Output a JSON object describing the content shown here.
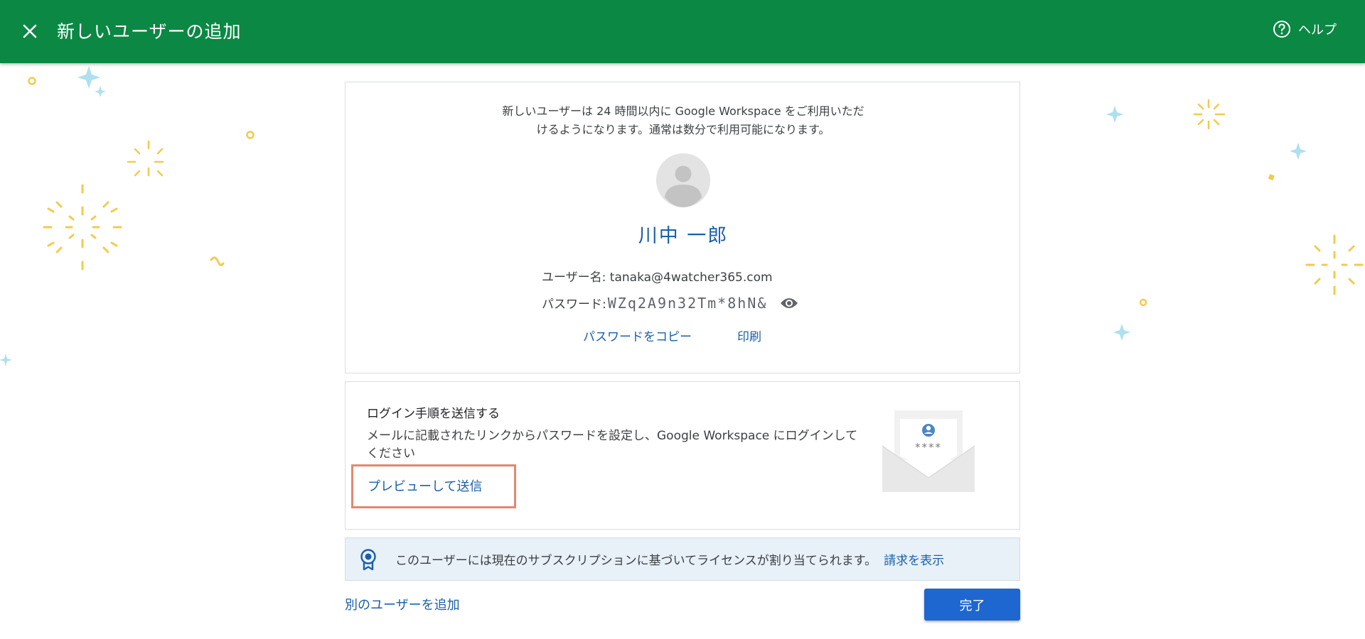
{
  "header": {
    "title": "新しいユーザーの追加",
    "help_label": "ヘルプ"
  },
  "info_card": {
    "intro_line1": "新しいユーザーは 24 時間以内に Google Workspace をご利用いただ",
    "intro_line2": "けるようになります。通常は数分で利用可能になります。",
    "user_display_name": "川中 一郎",
    "username_label": "ユーザー名:",
    "username_value": "tanaka@4watcher365.com",
    "password_label": "パスワード:",
    "password_value": "WZq2A9n32Tm*8hN&",
    "copy_password_label": "パスワードをコピー",
    "print_label": "印刷"
  },
  "login_card": {
    "title": "ログイン手順を送信する",
    "description": "メールに記載されたリンクからパスワードを設定し、Google Workspace にログインしてください",
    "preview_send_label": "プレビューして送信",
    "envelope_mask": "****"
  },
  "license_banner": {
    "text": "このユーザーには現在のサブスクリプションに基づいてライセンスが割り当てられます。",
    "link_label": "請求を表示"
  },
  "footer": {
    "add_another_label": "別のユーザーを追加",
    "done_label": "完了"
  },
  "colors": {
    "header_bg": "#0b8843",
    "link": "#1a5fa8",
    "primary_button": "#1e66d0",
    "highlight_box": "#e28870",
    "license_bg": "#e8f0f8"
  },
  "icons": {
    "close": "close-icon",
    "help": "help-circle-icon",
    "avatar": "person-avatar-icon",
    "eye": "eye-icon",
    "envelope": "envelope-icon",
    "license": "license-badge-icon"
  }
}
